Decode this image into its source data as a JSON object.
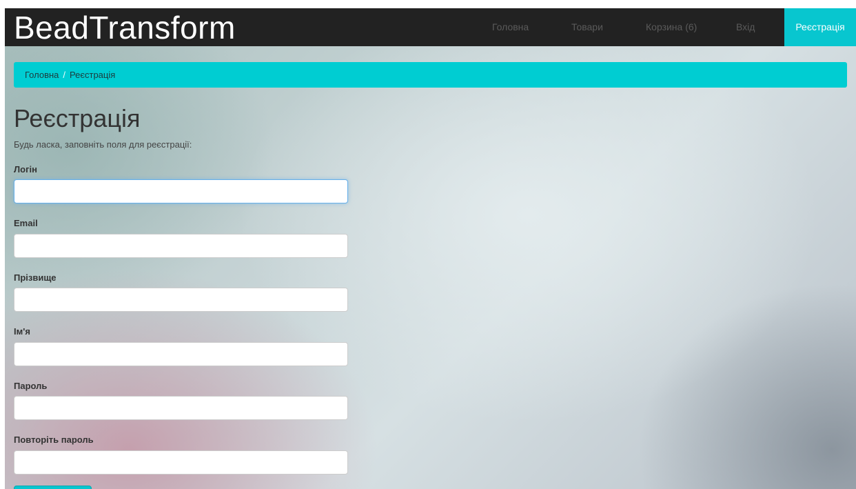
{
  "navbar": {
    "brand": "BeadTransform",
    "items": [
      {
        "label": "Головна"
      },
      {
        "label": "Товари"
      },
      {
        "label": "Корзина (6)"
      },
      {
        "label": "Вхід"
      },
      {
        "label": "Реєстрація",
        "active": true
      }
    ]
  },
  "breadcrumb": {
    "items": [
      "Головна",
      "Реєстрація"
    ],
    "separator": "/"
  },
  "page": {
    "title": "Реєстрація",
    "intro": "Будь ласка, заповніть поля для реєстрації:"
  },
  "form": {
    "fields": [
      {
        "label": "Логін",
        "value": ""
      },
      {
        "label": "Email",
        "value": ""
      },
      {
        "label": "Прізвище",
        "value": ""
      },
      {
        "label": "Ім'я",
        "value": ""
      },
      {
        "label": "Пароль",
        "value": ""
      },
      {
        "label": "Повторіть пароль",
        "value": ""
      }
    ]
  },
  "colors": {
    "navbar_bg": "#222222",
    "accent": "#08c6cf",
    "breadcrumb_bg": "#00cdd2",
    "nav_text": "#5a5a5a"
  }
}
